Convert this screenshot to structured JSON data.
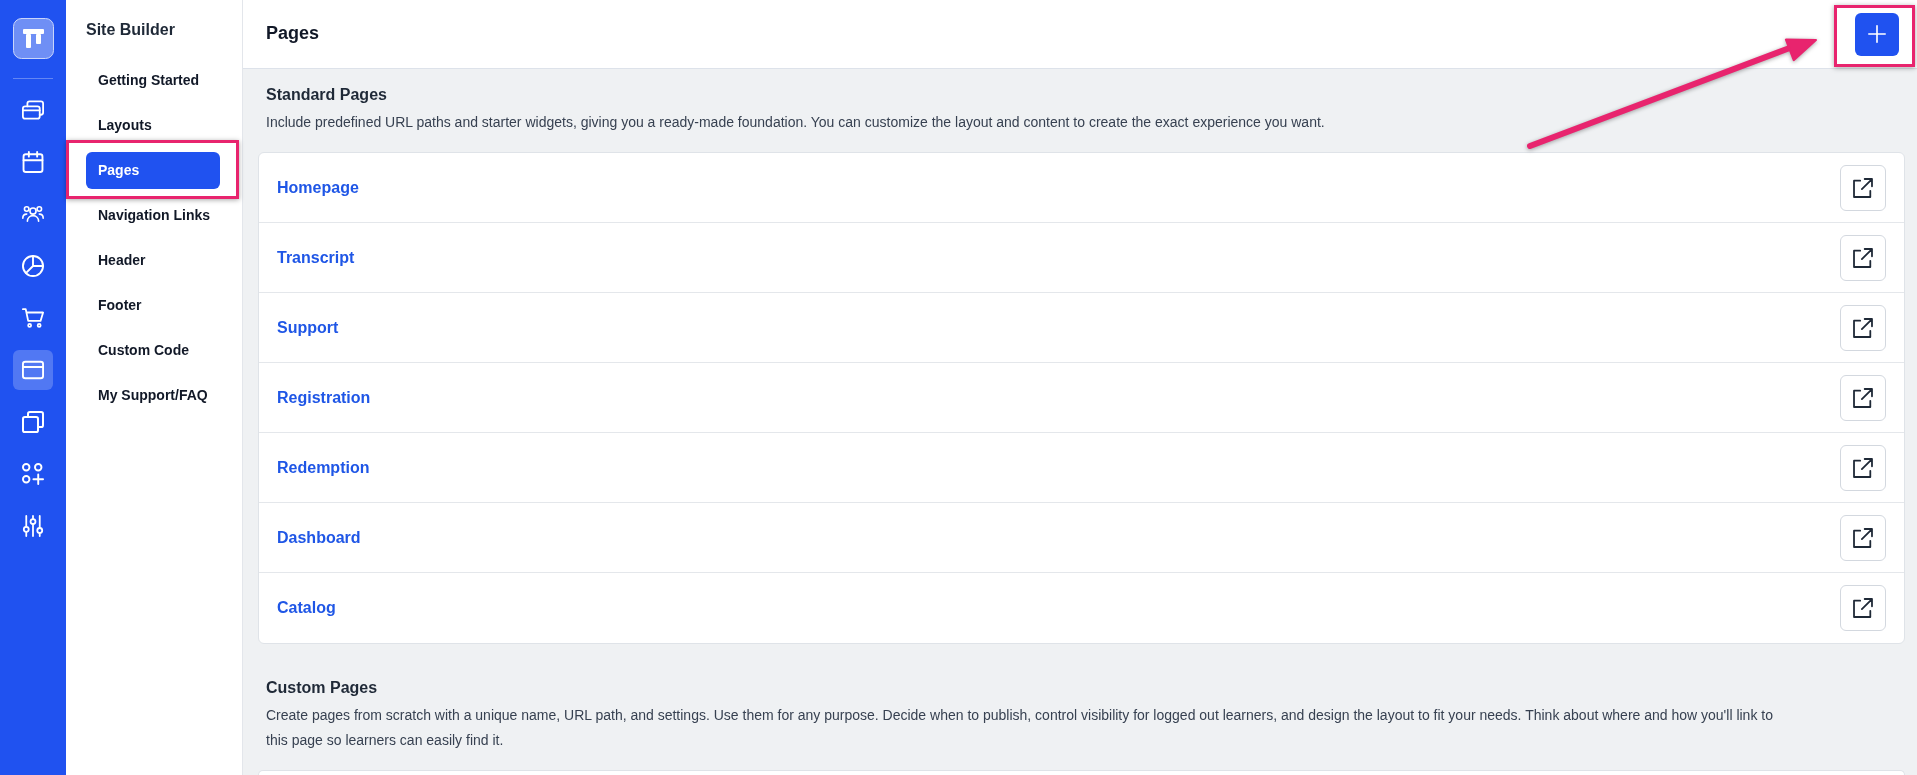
{
  "rail": {
    "items": [
      {
        "selected": false
      },
      {
        "selected": false
      },
      {
        "selected": false
      },
      {
        "selected": false
      },
      {
        "selected": false
      },
      {
        "selected": true
      },
      {
        "selected": false
      },
      {
        "selected": false
      },
      {
        "selected": false
      }
    ]
  },
  "sidebar": {
    "title": "Site Builder",
    "items": [
      {
        "label": "Getting Started",
        "selected": false,
        "highlighted": false
      },
      {
        "label": "Layouts",
        "selected": false,
        "highlighted": false
      },
      {
        "label": "Pages",
        "selected": true,
        "highlighted": true
      },
      {
        "label": "Navigation Links",
        "selected": false,
        "highlighted": false
      },
      {
        "label": "Header",
        "selected": false,
        "highlighted": false
      },
      {
        "label": "Footer",
        "selected": false,
        "highlighted": false
      },
      {
        "label": "Custom Code",
        "selected": false,
        "highlighted": false
      },
      {
        "label": "My Support/FAQ",
        "selected": false,
        "highlighted": false
      }
    ]
  },
  "header": {
    "title": "Pages",
    "add_button": {
      "highlighted": true
    }
  },
  "sections": [
    {
      "title": "Standard Pages",
      "description": "Include predefined URL paths and starter widgets, giving you a ready-made foundation. You can customize the layout and content to create the exact experience you want.",
      "pages": [
        {
          "label": "Homepage"
        },
        {
          "label": "Transcript"
        },
        {
          "label": "Support"
        },
        {
          "label": "Registration"
        },
        {
          "label": "Redemption"
        },
        {
          "label": "Dashboard"
        },
        {
          "label": "Catalog"
        }
      ]
    },
    {
      "title": "Custom Pages",
      "description": "Create pages from scratch with a unique name, URL path, and settings. Use them for any purpose. Decide when to publish, control visibility for logged out learners, and design the layout to fit your needs. Think about where and how you'll link to this page so learners can easily find it."
    }
  ]
}
